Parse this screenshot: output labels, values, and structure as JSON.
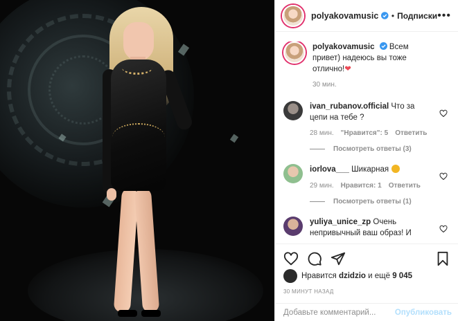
{
  "post": {
    "username": "polyakovamusic",
    "separator": "•",
    "follow_label": "Подписки",
    "more_label": "•••"
  },
  "caption": {
    "username": "polyakovamusic",
    "text": "Всем привет) надеюсь вы тоже отлично!",
    "heart": "❤",
    "time": "30 мин."
  },
  "comments": [
    {
      "username": "ivan_rubanov.official",
      "text": "Что за цепи на тебе ?",
      "time": "28 мин.",
      "likes": "\"Нравится\": 5",
      "reply": "Ответить",
      "replies": "Посмотреть ответы (3)"
    },
    {
      "username": "iorlova___",
      "text": "Шикарная",
      "time": "29 мин.",
      "likes": "Нравится: 1",
      "reply": "Ответить",
      "replies": "Посмотреть ответы (1)"
    },
    {
      "username": "yuliya_unice_zp",
      "text": "Очень непривычный ваш образ! И"
    }
  ],
  "likes_line": {
    "prefix": "Нравится",
    "user": "dzidzio",
    "suffix": "и ещё",
    "count": "9 045"
  },
  "timestamp": "30 МИНУТ НАЗАД",
  "comment_box": {
    "placeholder": "Добавьте комментарий...",
    "publish_label": "Опубликовать"
  },
  "colors": {
    "accent": "#0095f6",
    "publish_disabled": "#b2dffc",
    "muted": "#8e8e8e",
    "heart_red": "#ed4956"
  }
}
